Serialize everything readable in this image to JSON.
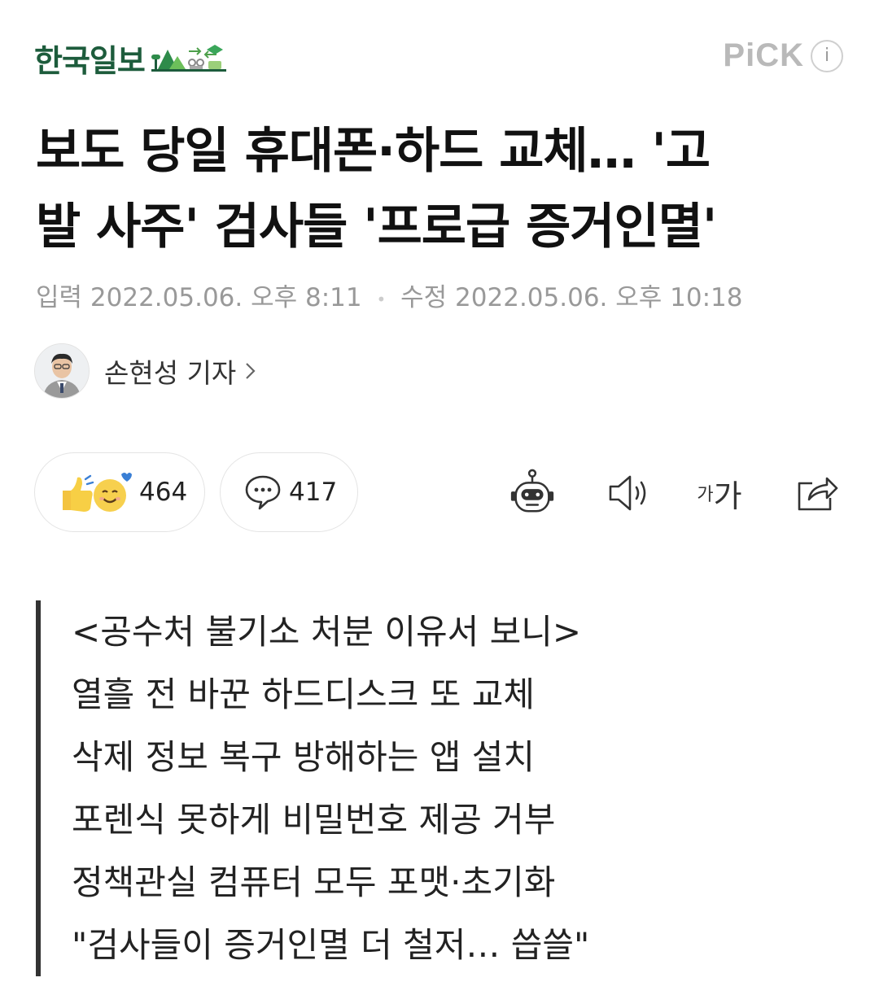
{
  "header": {
    "brand": "한국일보",
    "pick_label": "PiCK",
    "info_label": "i"
  },
  "article": {
    "headline_lines": [
      "보도 당일 휴대폰·하드 교체… '고",
      "발 사주' 검사들 '프로급 증거인멸'"
    ],
    "input_label": "입력",
    "input_time": "2022.05.06. 오후 8:11",
    "separator": "•",
    "modified_label": "수정",
    "modified_time": "2022.05.06. 오후 10:18",
    "reporter": "손현성 기자"
  },
  "actions": {
    "reaction_count": "464",
    "comment_count": "417",
    "font_size_label_small": "가",
    "font_size_label_large": "가"
  },
  "icons": {
    "reaction": "thumbs-up-smile-icon",
    "comment": "comment-bubble-icon",
    "summary_bot": "robot-icon",
    "tts": "speaker-icon",
    "font": "font-size-icon",
    "share": "share-icon"
  },
  "summary": {
    "lines": [
      "<공수처 불기소 처분 이유서 보니>",
      "열흘 전 바꾼 하드디스크 또 교체",
      "삭제 정보 복구 방해하는 앱 설치",
      "포렌식 못하게 비밀번호 제공 거부",
      "정책관실 컴퓨터 모두 포맷·초기화",
      "\"검사들이 증거인멸 더 철저… 씁쓸\""
    ]
  },
  "colors": {
    "brand_green": "#1d5c3c",
    "muted_gray": "#999999",
    "quote_bar": "#333333"
  }
}
